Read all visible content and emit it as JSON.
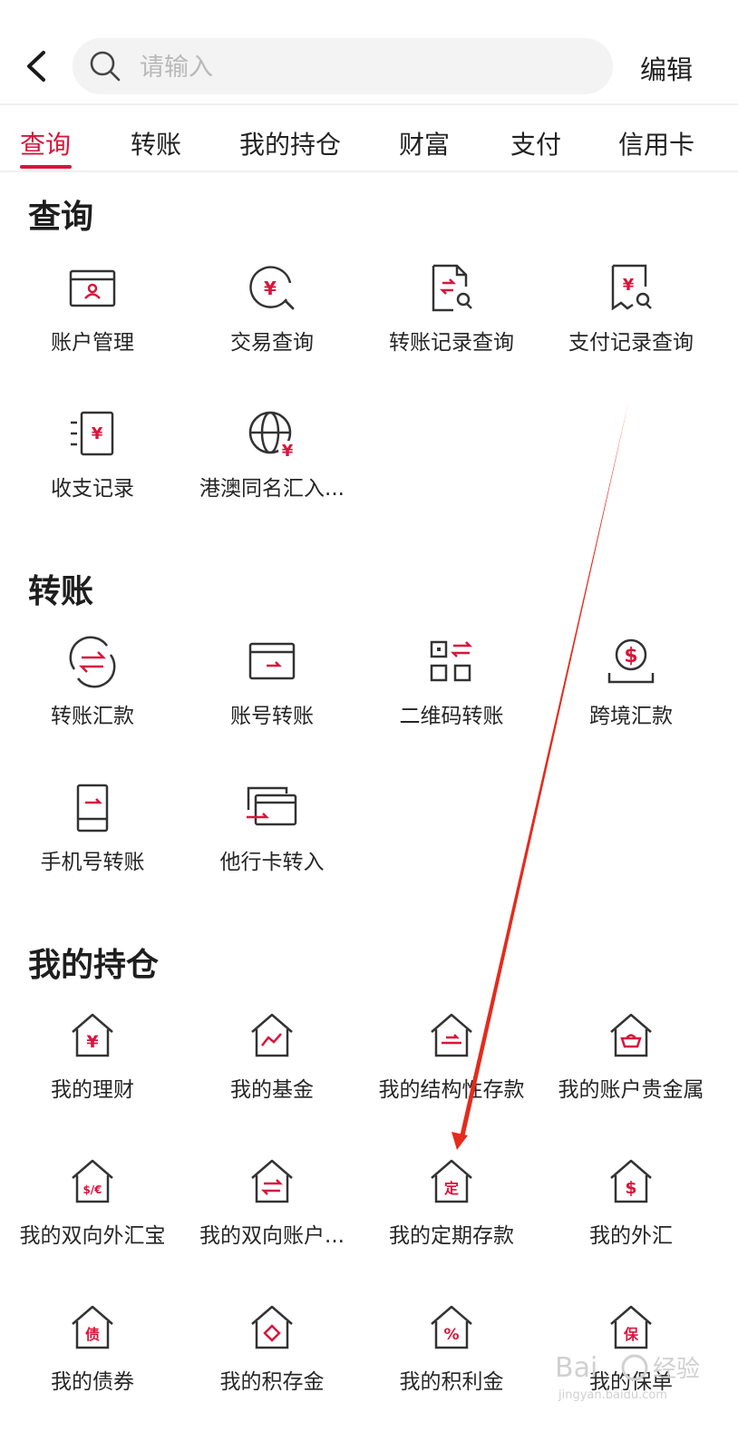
{
  "header": {
    "search_placeholder": "请输入",
    "edit_label": "编辑"
  },
  "tabs": [
    "查询",
    "转账",
    "我的持仓",
    "财富",
    "支付",
    "信用卡"
  ],
  "active_tab_index": 0,
  "accent_color": "#d9153b",
  "icon_stroke_color": "#333333",
  "sections": {
    "query": {
      "title": "查询",
      "items": [
        {
          "label": "账户管理",
          "icon": "account-card-icon"
        },
        {
          "label": "交易查询",
          "icon": "yuan-search-icon"
        },
        {
          "label": "转账记录查询",
          "icon": "transfer-document-search-icon"
        },
        {
          "label": "支付记录查询",
          "icon": "payment-document-search-icon"
        },
        {
          "label": "收支记录",
          "icon": "income-expense-record-icon"
        },
        {
          "label": "港澳同名汇入...",
          "icon": "globe-yuan-icon"
        }
      ]
    },
    "transfer": {
      "title": "转账",
      "items": [
        {
          "label": "转账汇款",
          "icon": "transfer-circle-icon"
        },
        {
          "label": "账号转账",
          "icon": "account-transfer-card-icon"
        },
        {
          "label": "二维码转账",
          "icon": "qr-code-transfer-icon"
        },
        {
          "label": "跨境汇款",
          "icon": "cross-border-dollar-icon"
        },
        {
          "label": "手机号转账",
          "icon": "mobile-transfer-icon"
        },
        {
          "label": "他行卡转入",
          "icon": "other-bank-card-icon"
        }
      ]
    },
    "holdings": {
      "title": "我的持仓",
      "items": [
        {
          "label": "我的理财",
          "icon": "house-yuan-icon"
        },
        {
          "label": "我的基金",
          "icon": "house-chart-icon"
        },
        {
          "label": "我的结构性存款",
          "icon": "house-structured-deposit-icon"
        },
        {
          "label": "我的账户贵金属",
          "icon": "house-precious-metal-icon"
        },
        {
          "label": "我的双向外汇宝",
          "icon": "house-forex-icon"
        },
        {
          "label": "我的双向账户...",
          "icon": "house-exchange-icon"
        },
        {
          "label": "我的定期存款",
          "icon": "house-fixed-deposit-icon"
        },
        {
          "label": "我的外汇",
          "icon": "house-dollar-icon"
        },
        {
          "label": "我的债券",
          "icon": "house-bond-icon"
        },
        {
          "label": "我的积存金",
          "icon": "house-diamond-icon"
        },
        {
          "label": "我的积利金",
          "icon": "house-percent-icon"
        },
        {
          "label": "我的保单",
          "icon": "house-insurance-icon"
        }
      ]
    }
  },
  "watermark": {
    "text": "Baidu 经验",
    "sub": "jingyan.baidu.com"
  }
}
